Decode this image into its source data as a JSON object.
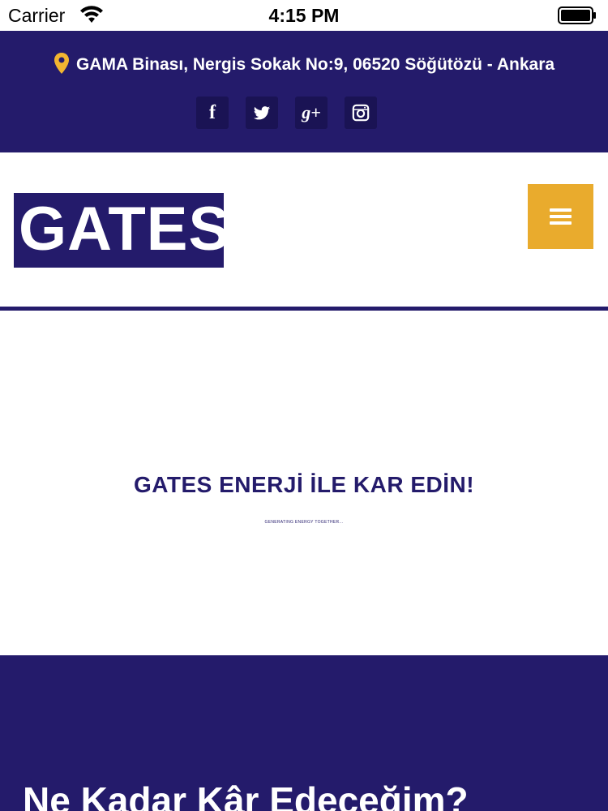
{
  "status_bar": {
    "carrier": "Carrier",
    "time": "4:15 PM"
  },
  "top_bar": {
    "address": "GAMA Binası, Nergis Sokak No:9, 06520 Söğütözü - Ankara",
    "socials": [
      {
        "name": "facebook",
        "glyph": "f"
      },
      {
        "name": "twitter",
        "glyph": "twitter-bird"
      },
      {
        "name": "google-plus",
        "glyph": "g+"
      },
      {
        "name": "instagram",
        "glyph": "instagram-camera"
      }
    ]
  },
  "header": {
    "logo_text": "GATES",
    "menu_icon": "hamburger-icon"
  },
  "hero": {
    "title": "GATES ENERJİ İLE KAR EDİN!",
    "subtitle": "GENERATING ENERGY TOGETHER..."
  },
  "section": {
    "title": "Ne Kadar Kâr Edeceğim?"
  },
  "colors": {
    "brand_navy": "#241b6b",
    "accent_gold": "#e9ab2d",
    "pin_gold": "#f2b531",
    "white": "#ffffff"
  }
}
